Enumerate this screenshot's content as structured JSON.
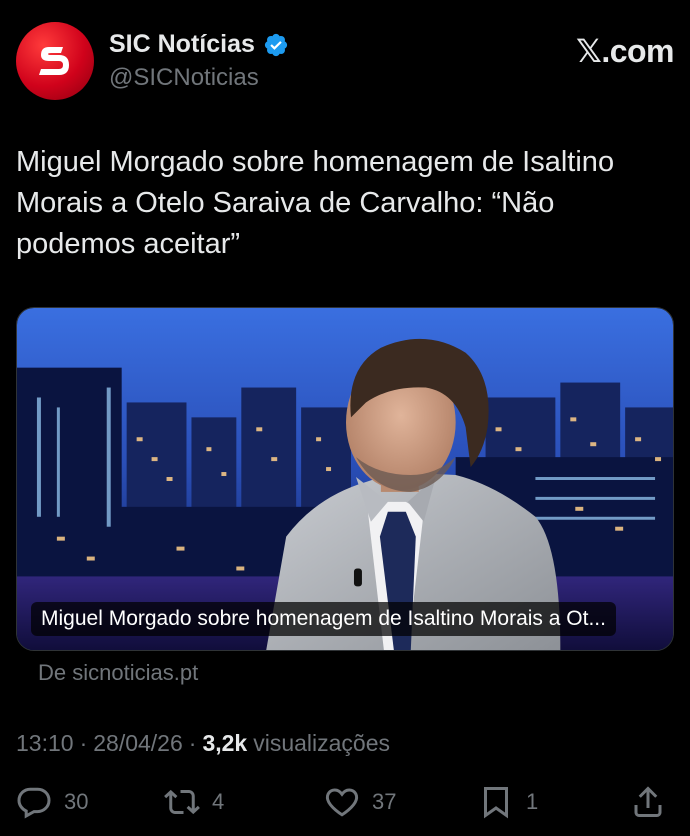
{
  "account": {
    "name": "SIC Notícias",
    "handle": "@SICNoticias",
    "site": "𝕏.com"
  },
  "tweet": {
    "text": "Miguel Morgado sobre homenagem de Isaltino Morais a Otelo Saraiva de Carvalho: “Não podemos aceitar”",
    "media_caption": "Miguel Morgado sobre homenagem de Isaltino Morais a Ot...",
    "source": "De sicnoticias.pt",
    "time": "13:10",
    "date": "28/04/26",
    "views_count": "3,2k",
    "views_label": "visualizações",
    "separator": "·"
  },
  "actions": {
    "replies": "30",
    "reposts": "4",
    "likes": "37",
    "bookmarks": "1"
  },
  "colors": {
    "background": "#000000",
    "text": "#e7e9ea",
    "muted": "#71767b",
    "verified": "#1d9bf0",
    "brand": "#d0021b"
  }
}
